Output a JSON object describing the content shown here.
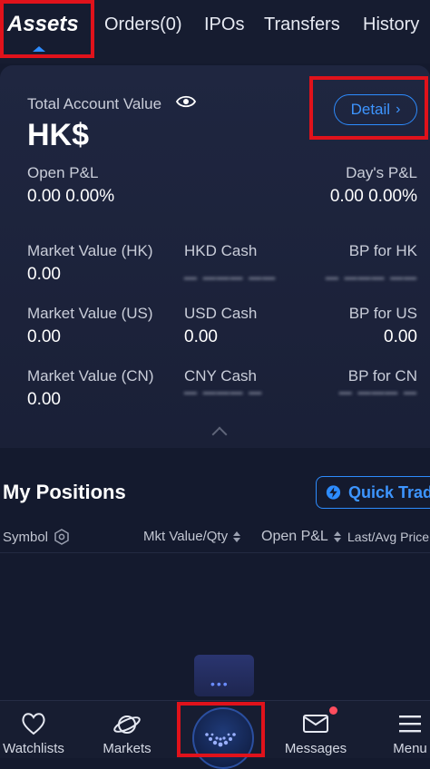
{
  "tabs": [
    {
      "label": "Assets"
    },
    {
      "label": "Orders(0)"
    },
    {
      "label": "IPOs"
    },
    {
      "label": "Transfers"
    },
    {
      "label": "History"
    }
  ],
  "account": {
    "total_label": "Total Account Value",
    "total_value": "HK$",
    "detail_label": "Detail",
    "open_pl_label": "Open P&L",
    "open_pl_value": "0.00 0.00%",
    "day_pl_label": "Day's P&L",
    "day_pl_value": "0.00 0.00%",
    "rows": [
      {
        "mv_label": "Market Value (HK)",
        "mv_value": "0.00",
        "cash_label": "HKD Cash",
        "bp_label": "BP for HK"
      },
      {
        "mv_label": "Market Value (US)",
        "mv_value": "0.00",
        "cash_label": "USD Cash",
        "cash_value": "0.00",
        "bp_label": "BP for US",
        "bp_value": "0.00"
      },
      {
        "mv_label": "Market Value (CN)",
        "mv_value": "0.00",
        "cash_label": "CNY Cash",
        "bp_label": "BP for CN"
      }
    ]
  },
  "positions": {
    "title": "My Positions",
    "quick_trade": "Quick Trade",
    "columns": [
      "Symbol",
      "Mkt Value/Qty",
      "Open P&L",
      "Last/Avg Price"
    ]
  },
  "nav": [
    {
      "label": "Watchlists",
      "icon": "heart-icon"
    },
    {
      "label": "Markets",
      "icon": "planet-icon"
    },
    {
      "label": "",
      "icon": "home-icon"
    },
    {
      "label": "Messages",
      "icon": "envelope-icon"
    },
    {
      "label": "Menu",
      "icon": "menu-icon"
    }
  ],
  "colors": {
    "accent": "#2d8cff",
    "background": "#141a2e",
    "highlight": "#e0121b"
  }
}
